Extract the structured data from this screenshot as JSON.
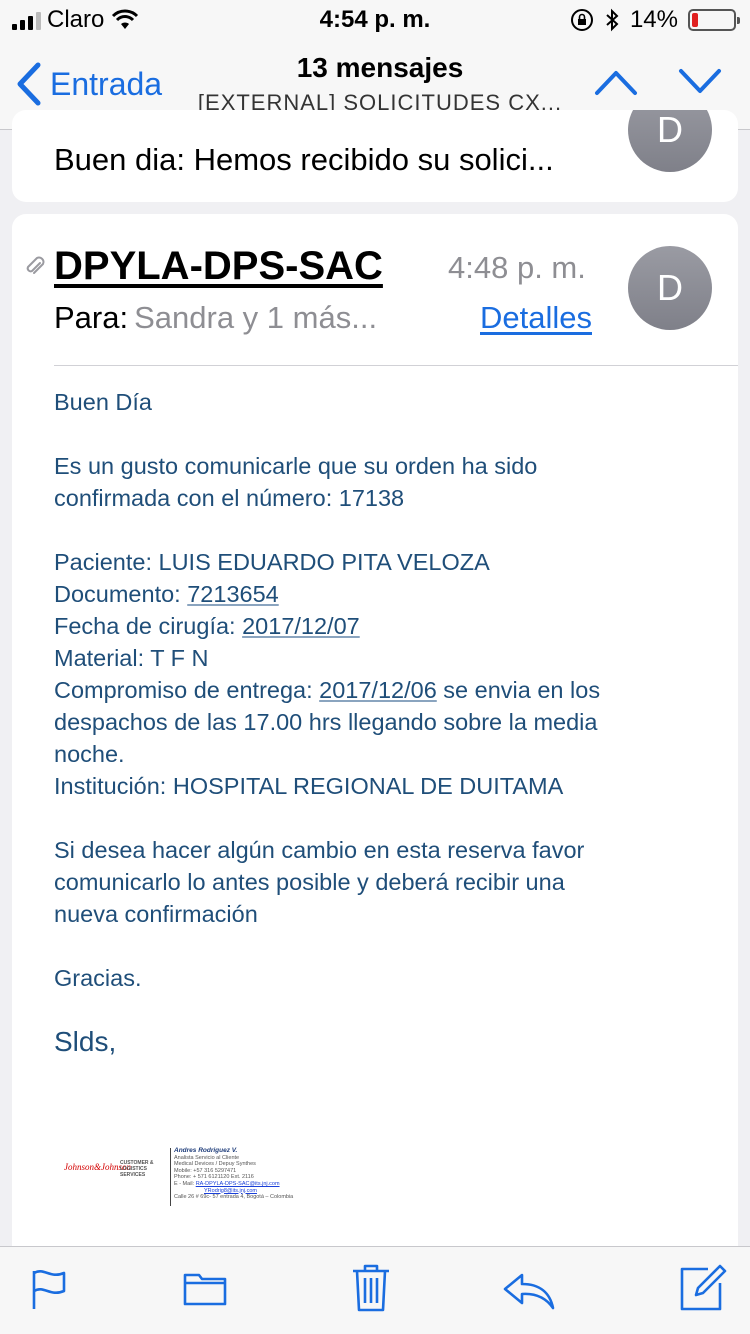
{
  "status_bar": {
    "carrier": "Claro",
    "time": "4:54 p. m.",
    "battery_percent": "14%",
    "battery_level": 0.14,
    "battery_color": "#e02020"
  },
  "nav": {
    "back_label": "Entrada",
    "message_count": "13 mensajes",
    "subject": "[EXTERNAL]  SOLICITUDES CX..."
  },
  "previous_message": {
    "snippet": "Buen dia: Hemos recibido su solici...",
    "avatar_initial": "D"
  },
  "message": {
    "sender": "DPYLA-DPS-SAC",
    "time": "4:48 p. m.",
    "to_label": "Para:",
    "to_value": "Sandra y 1 más...",
    "details_label": "Detalles",
    "avatar_initial": "D",
    "body": {
      "greeting": "Buen Día",
      "intro_line1": "Es un gusto comunicarle que su orden ha sido",
      "intro_line2": "confirmada con el número: 17138",
      "patient_label": "Paciente:  LUIS EDUARDO PITA VELOZA",
      "document_label": "Documento:  ",
      "document_value": "7213654",
      "surgery_label": "Fecha de cirugía: ",
      "surgery_date": "2017/12/07",
      "material": "Material: T F N",
      "delivery_label": "Compromiso de entrega:  ",
      "delivery_date": "2017/12/06",
      "delivery_rest1": " se envia en los",
      "delivery_rest2": "despachos de las 17.00 hrs llegando sobre la media",
      "delivery_rest3": "noche.",
      "institution": "Institución: HOSPITAL REGIONAL DE DUITAMA",
      "change_line1": "Si desea hacer algún cambio en esta reserva favor",
      "change_line2": "comunicarlo lo antes posible y deberá recibir una",
      "change_line3": "nueva confirmación",
      "thanks": "Gracias.",
      "closing": "Slds,"
    },
    "signature": {
      "logo_text": "Johnson&Johnson",
      "logo_sub": "CUSTOMER & LOGISTICS SERVICES",
      "name": "Andres Rodriguez V.",
      "role": "Analista Servicio al Cliente",
      "company": "Medical Devices / Depuy Synthes",
      "mobile": "Mobile: +57 316 5297471",
      "phone": "Phone: + 571 6121120  Ext. 2116",
      "email_label": "E - Mail: ",
      "email1": "RA-DPYLA-DPS-SAC@its.jnj.com",
      "email2": "YRodrig8@its.jnj.com",
      "address": "Calle 26 # 69c- 57 entrada  4, Bogotá – Colombia"
    }
  },
  "toolbar": {
    "icons": [
      "flag-icon",
      "folder-icon",
      "trash-icon",
      "reply-icon",
      "compose-icon"
    ]
  },
  "colors": {
    "accent": "#1a6de0",
    "body_text": "#1f4e79",
    "avatar": "#8a8b93"
  }
}
